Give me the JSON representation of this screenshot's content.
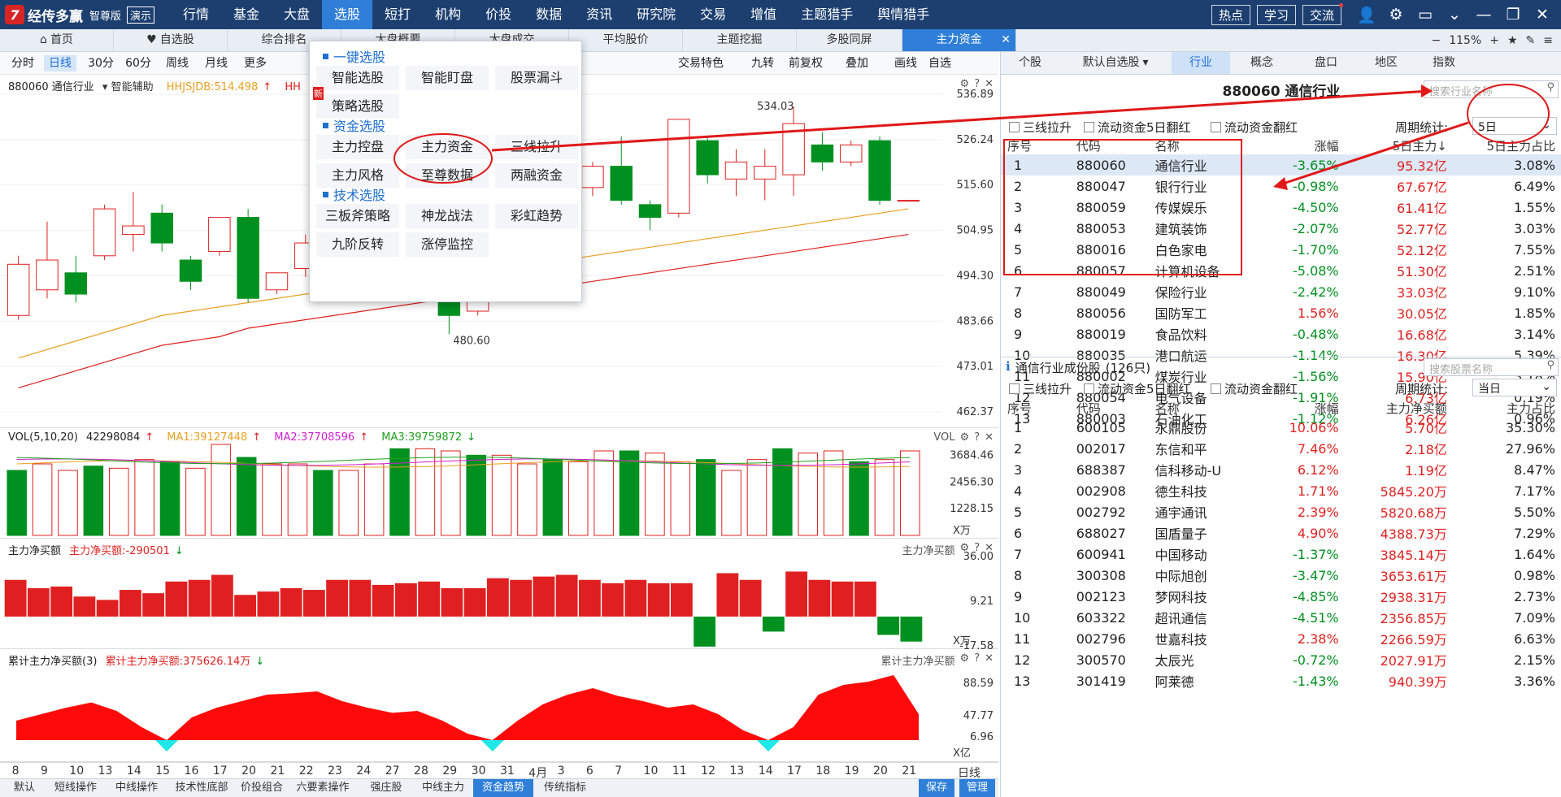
{
  "app": {
    "logo_mark": "7",
    "name": "经传多赢",
    "edition": "智尊版",
    "demo": "演示",
    "nav": [
      {
        "label": "行情",
        "dot": false
      },
      {
        "label": "基金",
        "dot": false
      },
      {
        "label": "大盘",
        "dot": false
      },
      {
        "label": "选股",
        "dot": true,
        "active": true
      },
      {
        "label": "短打",
        "dot": false
      },
      {
        "label": "机构",
        "dot": false
      },
      {
        "label": "价投",
        "dot": false
      },
      {
        "label": "数据",
        "dot": false
      },
      {
        "label": "资讯",
        "dot": false
      },
      {
        "label": "研究院",
        "dot": false
      },
      {
        "label": "交易",
        "dot": false
      },
      {
        "label": "增值",
        "dot": true
      },
      {
        "label": "主题猎手",
        "dot": false
      },
      {
        "label": "舆情猎手",
        "dot": true
      }
    ],
    "top_buttons": [
      {
        "label": "热点",
        "dot": false
      },
      {
        "label": "学习",
        "dot": false
      },
      {
        "label": "交流",
        "dot": true
      }
    ]
  },
  "tabs": [
    {
      "label": "首页",
      "icon": "home-icon",
      "icon_char": "⌂"
    },
    {
      "label": "自选股",
      "icon": "heart-icon",
      "icon_char": "♥"
    },
    {
      "label": "综合排名"
    },
    {
      "label": "大盘概要"
    },
    {
      "label": "大盘成交"
    },
    {
      "label": "平均股价"
    },
    {
      "label": "主题挖掘"
    },
    {
      "label": "多股同屏"
    },
    {
      "label": "主力资金",
      "active": true
    }
  ],
  "zoom": "115%",
  "periods": [
    "分时",
    "日线",
    "30分",
    "60分",
    "周线",
    "月线",
    "更多"
  ],
  "active_period": "日线",
  "chart_tools": [
    "交易特色",
    "九转",
    "前复权",
    "叠加",
    "画线",
    "自选"
  ],
  "stock_panel": {
    "code_name": "880060 通信行业",
    "assist": "智能辅助",
    "indicator1": "HHJSJDB:514.498",
    "indicator1_cut": "HH",
    "price_axis": [
      "536.89",
      "526.24",
      "515.60",
      "504.95",
      "494.30",
      "483.66",
      "473.01",
      "462.37"
    ],
    "high_label": "534.03",
    "low_label": "480.60"
  },
  "chart_data": [
    {
      "type": "candlestick",
      "title": "880060 通信行业",
      "categories": [
        "8",
        "9",
        "10",
        "13",
        "14",
        "15",
        "16",
        "17",
        "20",
        "21",
        "22",
        "23",
        "24",
        "27",
        "28",
        "29",
        "30",
        "31",
        "4月",
        "3",
        "6",
        "7",
        "10",
        "11",
        "12",
        "13",
        "14",
        "17",
        "18",
        "19",
        "20",
        "21"
      ],
      "ylim": [
        462.37,
        536.89
      ],
      "candles": [
        {
          "o": 485,
          "c": 497,
          "h": 499,
          "l": 484
        },
        {
          "o": 491,
          "c": 498,
          "h": 507,
          "l": 489
        },
        {
          "o": 495,
          "c": 490,
          "h": 499,
          "l": 488
        },
        {
          "o": 499,
          "c": 510,
          "h": 511,
          "l": 498
        },
        {
          "o": 504,
          "c": 506,
          "h": 514,
          "l": 500
        },
        {
          "o": 509,
          "c": 502,
          "h": 511,
          "l": 500
        },
        {
          "o": 498,
          "c": 493,
          "h": 499,
          "l": 491
        },
        {
          "o": 500,
          "c": 508,
          "h": 508,
          "l": 499
        },
        {
          "o": 508,
          "c": 489,
          "h": 510,
          "l": 488
        },
        {
          "o": 491,
          "c": 495,
          "h": 495,
          "l": 490
        },
        {
          "o": 496,
          "c": 502,
          "h": 504,
          "l": 494
        },
        {
          "o": 499,
          "c": 495,
          "h": 501,
          "l": 491
        },
        {
          "o": 496,
          "c": 502,
          "h": 503,
          "l": 495
        },
        {
          "o": 502,
          "c": 498,
          "h": 504,
          "l": 496
        },
        {
          "o": 497,
          "c": 493,
          "h": 499,
          "l": 491
        },
        {
          "o": 492,
          "c": 485,
          "h": 493,
          "l": 480.6
        },
        {
          "o": 486,
          "c": 490,
          "h": 493,
          "l": 485
        },
        {
          "o": 491,
          "c": 498,
          "h": 501,
          "l": 490
        },
        {
          "o": 498,
          "c": 505,
          "h": 507,
          "l": 497
        },
        {
          "o": 509,
          "c": 513,
          "h": 515,
          "l": 507
        },
        {
          "o": 515,
          "c": 520,
          "h": 521,
          "l": 513
        },
        {
          "o": 520,
          "c": 512,
          "h": 527,
          "l": 511
        },
        {
          "o": 511,
          "c": 508,
          "h": 512,
          "l": 505
        },
        {
          "o": 509,
          "c": 531,
          "h": 531,
          "l": 508
        },
        {
          "o": 526,
          "c": 518,
          "h": 527,
          "l": 516
        },
        {
          "o": 517,
          "c": 521,
          "h": 524,
          "l": 513
        },
        {
          "o": 517,
          "c": 520,
          "h": 524,
          "l": 512
        },
        {
          "o": 518,
          "c": 530,
          "h": 534.03,
          "l": 513
        },
        {
          "o": 525,
          "c": 521,
          "h": 528,
          "l": 519
        },
        {
          "o": 521,
          "c": 525,
          "h": 526,
          "l": 520
        },
        {
          "o": 526,
          "c": 512,
          "h": 527,
          "l": 511
        },
        {
          "o": 512,
          "c": 512,
          "h": 512,
          "l": 512
        }
      ],
      "ma_lines": [
        {
          "color": "#e8a020",
          "values": [
            475,
            477,
            479,
            481,
            483,
            485,
            486,
            487,
            488,
            489,
            490,
            491,
            492,
            493,
            494,
            494,
            495,
            496,
            497,
            498,
            499,
            500,
            501,
            502,
            503,
            504,
            505,
            506,
            507,
            508,
            509,
            510
          ]
        },
        {
          "color": "#e02020",
          "values": [
            468,
            470,
            472,
            474,
            476,
            478,
            479,
            480,
            482,
            483,
            484,
            485,
            486,
            487,
            488,
            489,
            489,
            490,
            491,
            492,
            493,
            494,
            495,
            496,
            497,
            498,
            499,
            500,
            501,
            502,
            503,
            504
          ]
        }
      ]
    },
    {
      "type": "bar",
      "title": "VOL(5,10,20)",
      "ylim": [
        0,
        4200
      ],
      "axis": [
        "3684.46",
        "2456.30",
        "1228.15"
      ],
      "unit": "X万",
      "values": [
        3000,
        3300,
        3000,
        3200,
        3100,
        3500,
        3400,
        3100,
        4200,
        3600,
        3300,
        3300,
        3000,
        3000,
        3300,
        4000,
        4000,
        3900,
        3700,
        3700,
        3300,
        3500,
        3400,
        3900,
        3900,
        3800,
        3400,
        3500,
        3000,
        3500,
        4000,
        3800,
        3900,
        3400,
        3500,
        3900
      ]
    },
    {
      "type": "bar",
      "title": "主力净买额",
      "ylim": [
        -17.58,
        36.0
      ],
      "axis": [
        "36.00",
        "9.21",
        "-17.58"
      ],
      "unit": "X万",
      "values": [
        22,
        17,
        18,
        12,
        10,
        16,
        14,
        21,
        22,
        25,
        13,
        15,
        17,
        16,
        22,
        22,
        19,
        20,
        21,
        17,
        17,
        23,
        22,
        24,
        25,
        22,
        20,
        22,
        20,
        20,
        -18,
        26,
        22,
        -9,
        27,
        22,
        21,
        21,
        -11,
        -15
      ]
    },
    {
      "type": "area",
      "title": "累计主力净买额(3)",
      "ylim": [
        6.96,
        88.59
      ],
      "axis": [
        "88.59",
        "47.77",
        "6.96"
      ],
      "unit": "X亿",
      "values": [
        30,
        40,
        50,
        58,
        45,
        20,
        0,
        35,
        50,
        60,
        70,
        72,
        75,
        60,
        50,
        42,
        45,
        30,
        10,
        0,
        30,
        55,
        70,
        80,
        68,
        60,
        50,
        55,
        40,
        15,
        0,
        20,
        70,
        85,
        90,
        100,
        40
      ]
    }
  ],
  "vol_header": {
    "name": "VOL(5,10,20)",
    "v": "42298084",
    "ma1": "MA1:39127448",
    "ma2": "MA2:37708596",
    "ma3": "MA3:39759872",
    "right": "VOL"
  },
  "net_header": {
    "name": "主力净买额",
    "value": "主力净买额:-290501",
    "right": "主力净买额"
  },
  "cum_header": {
    "name": "累计主力净买额(3)",
    "value": "累计主力净买额:375626.14万",
    "right": "累计主力净买额"
  },
  "dropdown": {
    "sections": [
      {
        "title": "一键选股",
        "items": [
          "智能选股",
          "智能盯盘",
          "股票漏斗",
          "策略选股"
        ]
      },
      {
        "title": "资金选股",
        "items": [
          "主力控盘",
          "主力资金",
          "三线拉升",
          "主力风格",
          "至尊数据",
          "两融资金"
        ]
      },
      {
        "title": "技术选股",
        "items": [
          "三板斧策略",
          "神龙战法",
          "彩虹趋势",
          "九阶反转",
          "涨停监控"
        ]
      }
    ],
    "new_tag": "新"
  },
  "x_axis": [
    "8",
    "9",
    "10",
    "13",
    "14",
    "15",
    "16",
    "17",
    "20",
    "21",
    "22",
    "23",
    "24",
    "27",
    "28",
    "29",
    "30",
    "31",
    "4月",
    "3",
    "6",
    "7",
    "10",
    "11",
    "12",
    "13",
    "14",
    "17",
    "18",
    "19",
    "20",
    "21"
  ],
  "x_axis_right": "日线",
  "bottom_tabs": [
    "默认",
    "短线操作",
    "中线操作",
    "技术性底部",
    "价投组合",
    "六要素操作",
    "强庄股",
    "中线主力",
    "资金趋势",
    "传统指标"
  ],
  "bottom_active": "资金趋势",
  "bottom_right": [
    "保存",
    "管理"
  ],
  "right_tabs": [
    "个股",
    "默认自选股",
    "行业",
    "概念",
    "盘口",
    "地区",
    "指数"
  ],
  "right_active": "行业",
  "industry": {
    "title": "880060  通信行业",
    "search_placeholder": "搜索行业名称",
    "checks": [
      "三线拉升",
      "流动资金5日翻红",
      "流动资金翻红"
    ],
    "period_label": "周期统计:",
    "period_value": "5日",
    "headers": [
      "序号",
      "代码",
      "名称",
      "涨幅",
      "5日主力↓",
      "5日主力占比"
    ],
    "rows": [
      [
        "1",
        "880060",
        "通信行业",
        "-3.65%",
        "95.32亿",
        "3.08%"
      ],
      [
        "2",
        "880047",
        "银行行业",
        "-0.98%",
        "67.67亿",
        "6.49%"
      ],
      [
        "3",
        "880059",
        "传媒娱乐",
        "-4.50%",
        "61.41亿",
        "1.55%"
      ],
      [
        "4",
        "880053",
        "建筑装饰",
        "-2.07%",
        "52.77亿",
        "3.03%"
      ],
      [
        "5",
        "880016",
        "白色家电",
        "-1.70%",
        "52.12亿",
        "7.55%"
      ],
      [
        "6",
        "880057",
        "计算机设备",
        "-5.08%",
        "51.30亿",
        "2.51%"
      ],
      [
        "7",
        "880049",
        "保险行业",
        "-2.42%",
        "33.03亿",
        "9.10%"
      ],
      [
        "8",
        "880056",
        "国防军工",
        "1.56%",
        "30.05亿",
        "1.85%"
      ],
      [
        "9",
        "880019",
        "食品饮料",
        "-0.48%",
        "16.68亿",
        "3.14%"
      ],
      [
        "10",
        "880035",
        "港口航运",
        "-1.14%",
        "16.30亿",
        "5.39%"
      ],
      [
        "11",
        "880002",
        "煤炭行业",
        "-1.56%",
        "15.90亿",
        "3.18%"
      ],
      [
        "12",
        "880054",
        "电气设备",
        "-1.91%",
        "6.73亿",
        "0.19%"
      ],
      [
        "13",
        "880003",
        "石油化工",
        "-1.12%",
        "6.26亿",
        "0.96%"
      ]
    ]
  },
  "components": {
    "title": "通信行业成份股",
    "count": "(126只)",
    "search_placeholder": "搜索股票名称",
    "checks": [
      "三线拉升",
      "流动资金5日翻红",
      "流动资金翻红"
    ],
    "period_label": "周期统计:",
    "period_value": "当日",
    "headers": [
      "序号",
      "代码",
      "名称",
      "涨幅",
      "主力净买额",
      "主力占比"
    ],
    "rows": [
      [
        "1",
        "600105",
        "永鼎股份",
        "10.06%",
        "5.70亿",
        "35.30%"
      ],
      [
        "2",
        "002017",
        "东信和平",
        "7.46%",
        "2.18亿",
        "27.96%"
      ],
      [
        "3",
        "688387",
        "信科移动-U",
        "6.12%",
        "1.19亿",
        "8.47%"
      ],
      [
        "4",
        "002908",
        "德生科技",
        "1.71%",
        "5845.20万",
        "7.17%"
      ],
      [
        "5",
        "002792",
        "通宇通讯",
        "2.39%",
        "5820.68万",
        "5.50%"
      ],
      [
        "6",
        "688027",
        "国盾量子",
        "4.90%",
        "4388.73万",
        "7.29%"
      ],
      [
        "7",
        "600941",
        "中国移动",
        "-1.37%",
        "3845.14万",
        "1.64%"
      ],
      [
        "8",
        "300308",
        "中际旭创",
        "-3.47%",
        "3653.61万",
        "0.98%"
      ],
      [
        "9",
        "002123",
        "梦网科技",
        "-4.85%",
        "2938.31万",
        "2.73%"
      ],
      [
        "10",
        "603322",
        "超讯通信",
        "-4.51%",
        "2356.85万",
        "7.09%"
      ],
      [
        "11",
        "002796",
        "世嘉科技",
        "2.38%",
        "2266.59万",
        "6.63%"
      ],
      [
        "12",
        "300570",
        "太辰光",
        "-0.72%",
        "2027.91万",
        "2.15%"
      ],
      [
        "13",
        "301419",
        "阿莱德",
        "-1.43%",
        "940.39万",
        "3.36%"
      ]
    ]
  },
  "colors": {
    "up": "#e02020",
    "down": "#009020",
    "accent": "#2f7fd8",
    "topbar": "#1c3f70",
    "annotation": "#e01818"
  }
}
